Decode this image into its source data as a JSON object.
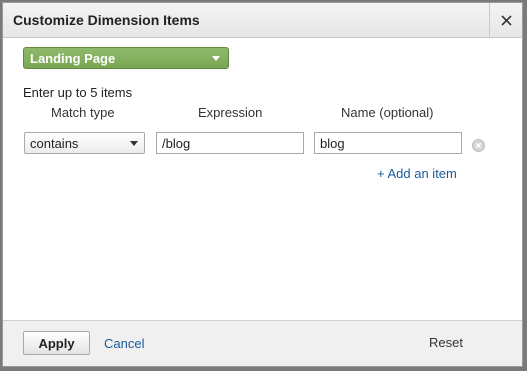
{
  "dialog": {
    "title": "Customize Dimension Items",
    "close_icon": "close-icon"
  },
  "dimension": {
    "selected": "Landing Page"
  },
  "instructions": "Enter up to 5 items",
  "columns": {
    "match_type": "Match type",
    "expression": "Expression",
    "name": "Name (optional)"
  },
  "items": [
    {
      "match_type": "contains",
      "expression": "/blog",
      "name": "blog"
    }
  ],
  "add_item_label": "+ Add an item",
  "footer": {
    "apply_label": "Apply",
    "cancel_label": "Cancel",
    "reset_label": "Reset"
  },
  "colors": {
    "accent_green": "#7aa653",
    "link_blue": "#1a5a9c"
  }
}
